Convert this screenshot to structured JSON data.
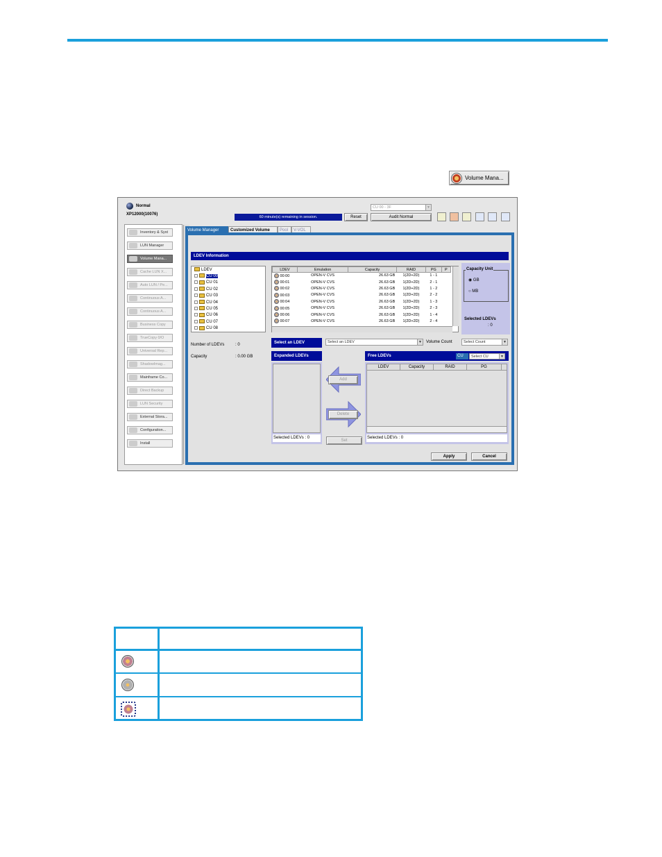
{
  "toolbar_button": {
    "label": "Volume Mana...",
    "icon": "volume-manager-icon"
  },
  "app": {
    "status": "Normal",
    "system": "XP12000(10076)",
    "session_text": "60 minute(s) remaining in session.",
    "reset_label": "Reset",
    "cu_select": "CU 00 - 3F",
    "audit_label": "Audit Normal"
  },
  "sidebar": {
    "items": [
      {
        "label": "Inventory & Syst",
        "icon": "inventory-icon"
      },
      {
        "label": "LUN Manager",
        "icon": "lun-manager-icon"
      },
      {
        "label": "Volume Mana...",
        "icon": "volume-manager-icon"
      },
      {
        "label": "Cache LUN X...",
        "icon": "cache-lun-icon"
      },
      {
        "label": "Auto LUN / Pe...",
        "icon": "auto-lun-icon"
      },
      {
        "label": "Continuous A...",
        "icon": "continuous-access-icon"
      },
      {
        "label": "Continuous A...",
        "icon": "continuous-access-icon"
      },
      {
        "label": "Business Copy",
        "icon": "business-copy-icon"
      },
      {
        "label": "TrueCopy 0/O",
        "icon": "truecopy-icon"
      },
      {
        "label": "Universal Rep...",
        "icon": "universal-replicator-icon"
      },
      {
        "label": "ShadowImag...",
        "icon": "shadowimage-icon"
      },
      {
        "label": "Mainframe Co...",
        "icon": "mainframe-icon"
      },
      {
        "label": "Direct Backup",
        "icon": "direct-backup-icon"
      },
      {
        "label": "LUN Security",
        "icon": "lun-security-icon"
      },
      {
        "label": "External Stora...",
        "icon": "external-storage-icon"
      },
      {
        "label": "Configuration...",
        "icon": "configuration-icon"
      },
      {
        "label": "Install",
        "icon": "install-icon"
      }
    ]
  },
  "tabs": [
    "Volume Manager",
    "Customized Volume",
    "Pool",
    "V-VOL"
  ],
  "ldev_info": {
    "title": "LDEV Information",
    "tree_root": "LDEV",
    "tree_items": [
      "CU 00",
      "CU 01",
      "CU 02",
      "CU 03",
      "CU 04",
      "CU 05",
      "CU 06",
      "CU 07",
      "CU 08"
    ],
    "columns": [
      "LDEV",
      "Emulation",
      "Capacity",
      "RAID",
      "PG",
      "P"
    ],
    "rows": [
      [
        "00:00",
        "OPEN-V CVS",
        "26.63 GB",
        "1(2D+2D)",
        "1 - 1"
      ],
      [
        "00:01",
        "OPEN-V CVS",
        "26.63 GB",
        "1(2D+2D)",
        "2 - 1"
      ],
      [
        "00:02",
        "OPEN-V CVS",
        "26.63 GB",
        "1(2D+2D)",
        "1 - 2"
      ],
      [
        "00:03",
        "OPEN-V CVS",
        "26.63 GB",
        "1(2D+2D)",
        "2 - 2"
      ],
      [
        "00:04",
        "OPEN-V CVS",
        "26.63 GB",
        "1(2D+2D)",
        "1 - 3"
      ],
      [
        "00:05",
        "OPEN-V CVS",
        "26.63 GB",
        "1(2D+2D)",
        "2 - 3"
      ],
      [
        "00:06",
        "OPEN-V CVS",
        "26.63 GB",
        "1(2D+2D)",
        "1 - 4"
      ],
      [
        "00:07",
        "OPEN-V CVS",
        "26.63 GB",
        "1(2D+2D)",
        "2 - 4"
      ]
    ],
    "capacity_unit": {
      "title": "Capacity Unit",
      "gb": "GB",
      "mb": "MB"
    },
    "selected_ldevs_label": "Selected LDEVs",
    "selected_ldevs_value": ": 0"
  },
  "summary": {
    "num_label": "Number of LDEVs",
    "num_value": ": 0",
    "cap_label": "Capacity",
    "cap_value": ": 0.00 GB"
  },
  "select_ldev": {
    "label": "Select an LDEV",
    "value": "Select an LDEV",
    "volume_count_label": "Volume Count",
    "volume_count_value": "Select Count"
  },
  "expanded": {
    "title": "Expanded LDEVs",
    "footer": "Selected LDEVs : 0"
  },
  "free": {
    "title": "Free LDEVs",
    "cu_label": "CU",
    "cu_value": "Select CU",
    "columns": [
      "LDEV",
      "Capacity",
      "RAID",
      "PG"
    ],
    "footer": "Selected LDEVs : 0"
  },
  "actions": {
    "add": "Add",
    "delete": "Delete",
    "set": "Set",
    "apply": "Apply",
    "cancel": "Cancel"
  },
  "legend": {
    "rows": [
      {
        "icon": "ldev-normal-icon"
      },
      {
        "icon": "ldev-blocked-icon"
      },
      {
        "icon": "ldev-selected-icon"
      }
    ]
  }
}
